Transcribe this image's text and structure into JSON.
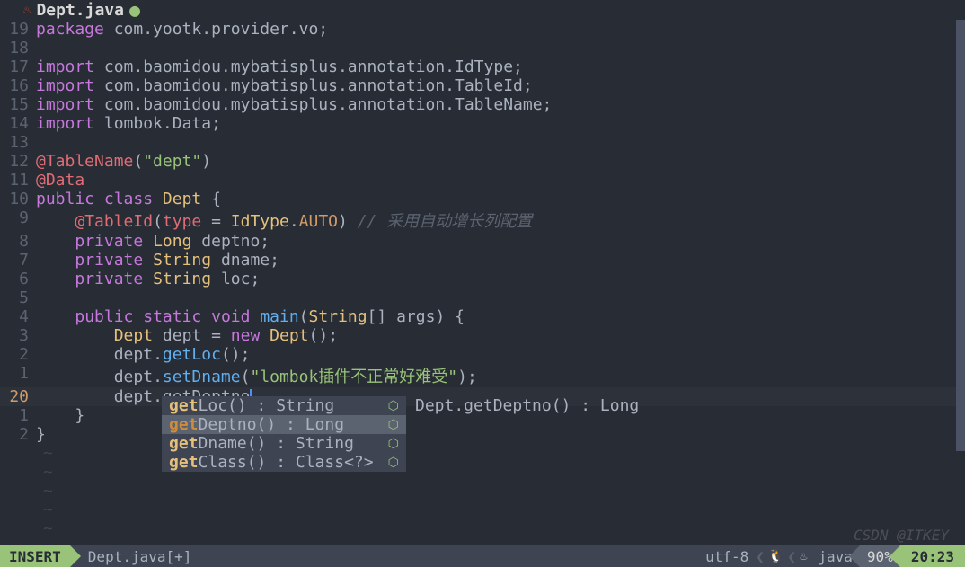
{
  "tab": {
    "filename": "Dept.java",
    "modified": true
  },
  "lines": [
    {
      "rn": "19",
      "tokens": [
        [
          "kw",
          "package"
        ],
        [
          "plain",
          " "
        ],
        [
          "plain",
          "com.yootk.provider.vo"
        ],
        [
          "punct",
          ";"
        ]
      ]
    },
    {
      "rn": "18",
      "tokens": []
    },
    {
      "rn": "17",
      "tokens": [
        [
          "kw",
          "import"
        ],
        [
          "plain",
          " "
        ],
        [
          "plain",
          "com.baomidou.mybatisplus.annotation.IdType"
        ],
        [
          "punct",
          ";"
        ]
      ]
    },
    {
      "rn": "16",
      "tokens": [
        [
          "kw",
          "import"
        ],
        [
          "plain",
          " "
        ],
        [
          "plain",
          "com.baomidou.mybatisplus.annotation.TableId"
        ],
        [
          "punct",
          ";"
        ]
      ]
    },
    {
      "rn": "15",
      "tokens": [
        [
          "kw",
          "import"
        ],
        [
          "plain",
          " "
        ],
        [
          "plain",
          "com.baomidou.mybatisplus.annotation.TableName"
        ],
        [
          "punct",
          ";"
        ]
      ]
    },
    {
      "rn": "14",
      "tokens": [
        [
          "kw",
          "import"
        ],
        [
          "plain",
          " "
        ],
        [
          "plain",
          "lombok.Data"
        ],
        [
          "punct",
          ";"
        ]
      ]
    },
    {
      "rn": "13",
      "tokens": []
    },
    {
      "rn": "12",
      "tokens": [
        [
          "anno",
          "@TableName"
        ],
        [
          "punct",
          "("
        ],
        [
          "str",
          "\"dept\""
        ],
        [
          "punct",
          ")"
        ]
      ]
    },
    {
      "rn": "11",
      "tokens": [
        [
          "anno",
          "@Data"
        ]
      ]
    },
    {
      "rn": "10",
      "tokens": [
        [
          "kw",
          "public"
        ],
        [
          "plain",
          " "
        ],
        [
          "kw",
          "class"
        ],
        [
          "plain",
          " "
        ],
        [
          "type",
          "Dept"
        ],
        [
          "plain",
          " "
        ],
        [
          "punct",
          "{"
        ]
      ]
    },
    {
      "rn": "9",
      "tokens": [
        [
          "plain",
          "    "
        ],
        [
          "anno",
          "@TableId"
        ],
        [
          "punct",
          "("
        ],
        [
          "ident",
          "type"
        ],
        [
          "plain",
          " "
        ],
        [
          "punct",
          "="
        ],
        [
          "plain",
          " "
        ],
        [
          "type",
          "IdType"
        ],
        [
          "punct",
          "."
        ],
        [
          "const",
          "AUTO"
        ],
        [
          "punct",
          ")"
        ],
        [
          "plain",
          " "
        ],
        [
          "comment",
          "// 采用自动增长列配置"
        ]
      ]
    },
    {
      "rn": "8",
      "tokens": [
        [
          "plain",
          "    "
        ],
        [
          "kw",
          "private"
        ],
        [
          "plain",
          " "
        ],
        [
          "type",
          "Long"
        ],
        [
          "plain",
          " "
        ],
        [
          "plain",
          "deptno"
        ],
        [
          "punct",
          ";"
        ]
      ]
    },
    {
      "rn": "7",
      "tokens": [
        [
          "plain",
          "    "
        ],
        [
          "kw",
          "private"
        ],
        [
          "plain",
          " "
        ],
        [
          "type",
          "String"
        ],
        [
          "plain",
          " "
        ],
        [
          "plain",
          "dname"
        ],
        [
          "punct",
          ";"
        ]
      ]
    },
    {
      "rn": "6",
      "tokens": [
        [
          "plain",
          "    "
        ],
        [
          "kw",
          "private"
        ],
        [
          "plain",
          " "
        ],
        [
          "type",
          "String"
        ],
        [
          "plain",
          " "
        ],
        [
          "plain",
          "loc"
        ],
        [
          "punct",
          ";"
        ]
      ]
    },
    {
      "rn": "5",
      "tokens": []
    },
    {
      "rn": "4",
      "tokens": [
        [
          "plain",
          "    "
        ],
        [
          "kw",
          "public"
        ],
        [
          "plain",
          " "
        ],
        [
          "kw",
          "static"
        ],
        [
          "plain",
          " "
        ],
        [
          "kw",
          "void"
        ],
        [
          "plain",
          " "
        ],
        [
          "fn",
          "main"
        ],
        [
          "punct",
          "("
        ],
        [
          "type",
          "String"
        ],
        [
          "punct",
          "[]"
        ],
        [
          "plain",
          " "
        ],
        [
          "plain",
          "args"
        ],
        [
          "punct",
          ")"
        ],
        [
          "plain",
          " "
        ],
        [
          "punct",
          "{"
        ]
      ]
    },
    {
      "rn": "3",
      "tokens": [
        [
          "plain",
          "        "
        ],
        [
          "type",
          "Dept"
        ],
        [
          "plain",
          " "
        ],
        [
          "plain",
          "dept"
        ],
        [
          "plain",
          " "
        ],
        [
          "punct",
          "="
        ],
        [
          "plain",
          " "
        ],
        [
          "kw",
          "new"
        ],
        [
          "plain",
          " "
        ],
        [
          "type",
          "Dept"
        ],
        [
          "punct",
          "();"
        ]
      ]
    },
    {
      "rn": "2",
      "tokens": [
        [
          "plain",
          "        "
        ],
        [
          "plain",
          "dept"
        ],
        [
          "punct",
          "."
        ],
        [
          "fn",
          "getLoc"
        ],
        [
          "punct",
          "();"
        ]
      ]
    },
    {
      "rn": "1",
      "tokens": [
        [
          "plain",
          "        "
        ],
        [
          "plain",
          "dept"
        ],
        [
          "punct",
          "."
        ],
        [
          "fn",
          "setDname"
        ],
        [
          "punct",
          "("
        ],
        [
          "str",
          "\"lombok插件不正常好难受\""
        ],
        [
          "punct",
          ");"
        ]
      ]
    },
    {
      "rn": "20",
      "current": true,
      "tokens": [
        [
          "plain",
          "        "
        ],
        [
          "plain",
          "dept"
        ],
        [
          "punct",
          "."
        ],
        [
          "plain",
          "getDeptno"
        ]
      ],
      "cursor": true
    },
    {
      "rn": "1",
      "tokens": [
        [
          "plain",
          "    "
        ],
        [
          "punct",
          "}"
        ]
      ]
    },
    {
      "rn": "2",
      "tokens": [
        [
          "punct",
          "}"
        ]
      ]
    }
  ],
  "popup": {
    "items": [
      {
        "match": "get",
        "rest": "Loc() : String",
        "selected": false
      },
      {
        "match": "get",
        "rest": "Deptno() : Long",
        "selected": true
      },
      {
        "match": "get",
        "rest": "Dname() : String",
        "selected": false
      },
      {
        "match": "get",
        "rest": "Class() : Class<?>",
        "selected": false
      }
    ],
    "signature": "Dept.getDeptno() : Long"
  },
  "statusline": {
    "mode": "INSERT",
    "file": "Dept.java[+]",
    "encoding": "utf-8",
    "filetype": "java",
    "percent": "90%",
    "position": "20:23"
  },
  "watermark": "CSDN @ITKEY"
}
